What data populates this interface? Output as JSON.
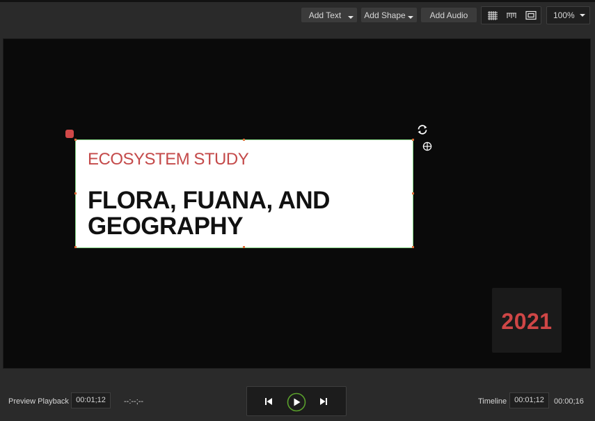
{
  "toolbar": {
    "add_text_label": "Add Text",
    "add_shape_label": "Add Shape",
    "add_audio_label": "Add Audio",
    "view_icons": [
      "grid-icon",
      "ruler-icon",
      "safe-area-icon"
    ],
    "zoom_value": "100%"
  },
  "canvas": {
    "card": {
      "subtitle": "ECOSYSTEM STUDY",
      "headline": "FLORA, FUANA, AND GEOGRAPHY"
    },
    "year_badge": "2021",
    "colors": {
      "accent_red": "#cf4646",
      "selection_green": "#7fd17f",
      "stage_bg": "#0a0a0a"
    },
    "handle_icons": [
      "rotate-icon",
      "move-icon"
    ]
  },
  "playback": {
    "preview_label": "Preview Playback",
    "preview_timecode": "00:01;12",
    "preview_end_timecode": "--:--;--",
    "timeline_label": "Timeline",
    "timeline_timecode": "00:01;12",
    "timeline_duration": "00:00;16",
    "transport_icons": [
      "skip-back-icon",
      "play-icon",
      "skip-forward-icon"
    ],
    "play_accent": "#5aa02c"
  }
}
